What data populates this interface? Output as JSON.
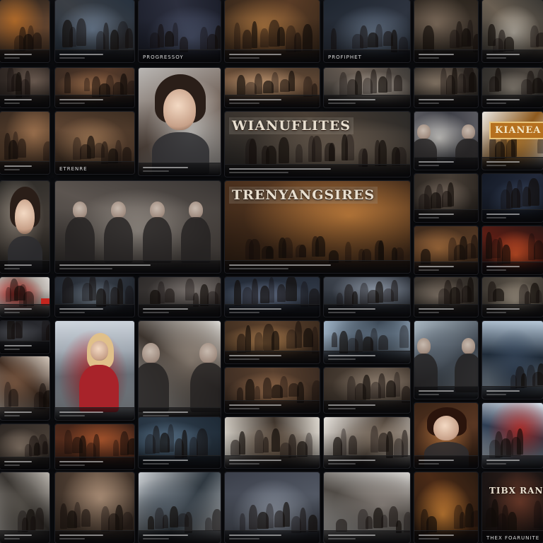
{
  "wall": {
    "tiles": [
      {
        "label": "",
        "palette": [
          "#3a2c22",
          "#b06a2a",
          "#6b4a33"
        ]
      },
      {
        "label": "",
        "palette": [
          "#27323f",
          "#6c7d92",
          "#3b3f45"
        ]
      },
      {
        "label": "PROGRESSOY",
        "palette": [
          "#1c1f2b",
          "#4f5872",
          "#2c2f3e"
        ]
      },
      {
        "label": "",
        "palette": [
          "#3b2a1c",
          "#a7733f",
          "#5a3c26"
        ]
      },
      {
        "label": "PROFIPHET",
        "palette": [
          "#1f2630",
          "#6b7b8f",
          "#2e3440"
        ]
      },
      {
        "label": "",
        "palette": [
          "#2d261f",
          "#7b6a5a",
          "#3c332b"
        ]
      },
      {
        "label": "",
        "palette": [
          "#3a3834",
          "#b9b2a6",
          "#6a5f52"
        ]
      },
      {
        "label": "",
        "palette": [
          "#2a2320",
          "#6a5a50",
          "#3d332c"
        ]
      },
      {
        "label": "",
        "palette": [
          "#3a2b22",
          "#a0704c",
          "#553a2a"
        ]
      },
      {
        "label": "",
        "palette": [
          "#b9b6b3",
          "#e6e3df",
          "#6a5a50"
        ],
        "portrait": "girl"
      },
      {
        "label": "",
        "palette": [
          "#4b3a2c",
          "#c39a74",
          "#6b4e38"
        ]
      },
      {
        "label": "",
        "palette": [
          "#3d3a37",
          "#b7aea4",
          "#6b5f55"
        ]
      },
      {
        "label": "",
        "palette": [
          "#2e2a26",
          "#857666",
          "#433a33"
        ]
      },
      {
        "label": "",
        "palette": [
          "#2f2d2a",
          "#8a8277",
          "#48423c"
        ]
      },
      {
        "label": "",
        "palette": [
          "#3c2d22",
          "#9c714e",
          "#5a412e"
        ]
      },
      {
        "label": "ETRENRE",
        "palette": [
          "#3d2e22",
          "#a47b57",
          "#5d4432"
        ]
      },
      {
        "label": "",
        "palette": [
          "#2c2a28",
          "#7a6c5e",
          "#4a3f35"
        ],
        "title": "WIANUFLITES"
      },
      {
        "label": "",
        "palette": [
          "#5a5a60",
          "#c8c6c2",
          "#3e3f47"
        ],
        "portrait": "pair"
      },
      {
        "label": "",
        "palette": [
          "#e9e6e1",
          "#c78a3a",
          "#8d5a1f"
        ],
        "banner": "KIANEA"
      },
      {
        "label": "",
        "palette": [
          "#2c2a27",
          "#8d8378",
          "#47403a"
        ],
        "portrait": "man"
      },
      {
        "label": "",
        "palette": [
          "#3a3634",
          "#a09890",
          "#5c5550"
        ],
        "portrait": "group"
      },
      {
        "label": "",
        "palette": [
          "#3a2618",
          "#b8783a",
          "#5a3a22"
        ],
        "title": "TRENYANGSIRES"
      },
      {
        "label": "",
        "palette": [
          "#2e2823",
          "#7d6f63",
          "#463d35"
        ]
      },
      {
        "label": "",
        "palette": [
          "#141a26",
          "#3b4a63",
          "#22293a"
        ]
      },
      {
        "label": "",
        "palette": [
          "#3d2a1c",
          "#a26c3d",
          "#5b3d26"
        ]
      },
      {
        "label": "",
        "palette": [
          "#2a1614",
          "#d8562a",
          "#5a1d14"
        ]
      },
      {
        "label": "",
        "palette": [
          "#d9d6d2",
          "#b52a26",
          "#8a7d74"
        ]
      },
      {
        "label": "",
        "palette": [
          "#22272f",
          "#6f7b88",
          "#353c46"
        ]
      },
      {
        "label": "",
        "palette": [
          "#2e2b2a",
          "#7c7571",
          "#45403e"
        ]
      },
      {
        "label": "",
        "palette": [
          "#212834",
          "#6a7790",
          "#313a48"
        ]
      },
      {
        "label": "",
        "palette": [
          "#2a2f37",
          "#8a94a2",
          "#3e444e"
        ]
      },
      {
        "label": "",
        "palette": [
          "#2b2824",
          "#7f7367",
          "#433b34"
        ]
      },
      {
        "label": "",
        "palette": [
          "#3b3630",
          "#a49888",
          "#5c544a"
        ]
      },
      {
        "label": "",
        "palette": [
          "#1c1d21",
          "#4a4c52",
          "#2a2b30"
        ]
      },
      {
        "label": "",
        "palette": [
          "#cfd6de",
          "#b9272c",
          "#7f8892"
        ],
        "portrait": "blonde"
      },
      {
        "label": "",
        "palette": [
          "#dedcd8",
          "#8b7f74",
          "#3b332d"
        ],
        "portrait": "soldier"
      },
      {
        "label": "",
        "palette": [
          "#3d2c1f",
          "#b0804f",
          "#5c412c"
        ]
      },
      {
        "label": "",
        "palette": [
          "#9fb4c8",
          "#5a6a7a",
          "#2c3642"
        ]
      },
      {
        "label": "",
        "palette": [
          "#a9b7c2",
          "#5b6672",
          "#3b434d"
        ],
        "portrait": "helmet"
      },
      {
        "label": "",
        "palette": [
          "#b7c8d8",
          "#3d4f66",
          "#23303f"
        ]
      },
      {
        "label": "",
        "palette": [
          "#d3c7bb",
          "#7d5a43",
          "#3b2a20"
        ]
      },
      {
        "label": "",
        "palette": [
          "#3c2c22",
          "#9e7250",
          "#5a412f"
        ]
      },
      {
        "label": "",
        "palette": [
          "#3a3028",
          "#8f7f70",
          "#564a3f"
        ]
      },
      {
        "label": "",
        "palette": [
          "#2e2824",
          "#8a7a6c",
          "#473d35"
        ]
      },
      {
        "label": "",
        "palette": [
          "#3b2218",
          "#a4532c",
          "#552c1c"
        ]
      },
      {
        "label": "",
        "palette": [
          "#1e2a36",
          "#5f7a92",
          "#2c3a48"
        ]
      },
      {
        "label": "",
        "palette": [
          "#ddd8cf",
          "#7d6a58",
          "#3e342c"
        ]
      },
      {
        "label": "",
        "palette": [
          "#e7e3dd",
          "#8b7c6d",
          "#4b4037"
        ]
      },
      {
        "label": "",
        "palette": [
          "#3a2416",
          "#c07a42",
          "#5b3824"
        ],
        "portrait": "boy"
      },
      {
        "label": "",
        "palette": [
          "#d7e0e9",
          "#b2302d",
          "#2f3f55"
        ]
      },
      {
        "label": "",
        "palette": [
          "#b9b4ad",
          "#5f5a53",
          "#3a3632"
        ]
      },
      {
        "label": "",
        "palette": [
          "#3e3128",
          "#a98d76",
          "#5c4a3c"
        ]
      },
      {
        "label": "",
        "palette": [
          "#c8ccd0",
          "#5a6570",
          "#2f3840"
        ]
      },
      {
        "label": "",
        "palette": [
          "#3b3f4a",
          "#9aa2b0",
          "#545a66"
        ]
      },
      {
        "label": "",
        "palette": [
          "#d4d2cf",
          "#8e8680",
          "#4f4a45"
        ]
      },
      {
        "label": "",
        "palette": [
          "#2b1c12",
          "#d98a3a",
          "#4a2a16"
        ]
      },
      {
        "label": "THEX FOARUNITE",
        "palette": [
          "#1a1413",
          "#6b3a2a",
          "#2a1c18"
        ],
        "title_dark": "TIBX RANNIC"
      }
    ]
  }
}
